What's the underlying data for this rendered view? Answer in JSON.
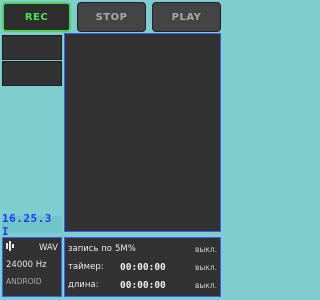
{
  "toolbar": {
    "rec_label": "REC",
    "stop_label": "STOP",
    "play_label": "PLAY"
  },
  "time_display": "16.25.3 I",
  "format": {
    "codec": "WAV",
    "channels_icon": "stereo-icon",
    "sample_rate": "24000 Hz",
    "mode": "ANDROID"
  },
  "info": {
    "row1_label": "запись по",
    "row1_value": "5M%",
    "row1_state": "выкл.",
    "row2_label": "таймер:",
    "row2_value": "00:00:00",
    "row2_state": "выкл.",
    "row3_label": "длина:",
    "row3_value": "00:00:00",
    "row3_state": "выкл."
  },
  "colors": {
    "background": "#7fcdcf",
    "panel": "#323232",
    "accent_green": "#4fd24f",
    "accent_blue": "#3a5bff"
  }
}
